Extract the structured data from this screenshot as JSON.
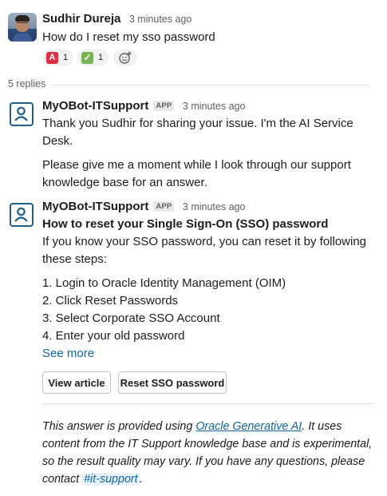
{
  "parent": {
    "author": "Sudhir Dureja",
    "time": "3 minutes ago",
    "text": "How do I reset my sso password",
    "reactions": [
      {
        "emoji": "A",
        "icon": "a-button-emoji-icon",
        "count": "1"
      },
      {
        "emoji": "✓",
        "icon": "check-mark-emoji-icon",
        "count": "1"
      }
    ]
  },
  "thread": {
    "replies_label": "5 replies"
  },
  "reply1": {
    "author": "MyOBot-ITSupport",
    "badge": "APP",
    "time": "3 minutes ago",
    "para1": "Thank you Sudhir for sharing your issue. I'm the AI Service Desk.",
    "para2": "Please give me a moment while I look through our support knowledge base for an answer."
  },
  "reply2": {
    "author": "MyOBot-ITSupport",
    "badge": "APP",
    "time": "3 minutes ago",
    "heading": "How to reset your Single Sign-On (SSO) password",
    "intro": "If you know your SSO password, you can reset it by following these steps:",
    "steps": [
      "1. Login to Oracle Identity Management (OIM)",
      "2. Click Reset Passwords",
      "3. Select Corporate SSO Account",
      "4. Enter your old password"
    ],
    "see_more": "See more",
    "buttons": {
      "view_article": "View article",
      "reset_sso": "Reset SSO password"
    },
    "disclaimer": {
      "prefix": "This answer is provided using ",
      "link": "Oracle Generative AI",
      "middle": ". It uses content from the IT Support knowledge base and is experimental, so the result quality may vary. If you have any questions, please contact ",
      "channel": "#it-support",
      "suffix": "."
    }
  },
  "colors": {
    "link": "#1264a3",
    "bot_icon": "#1e5f8a",
    "reaction_bg": "#f1f1f1"
  }
}
